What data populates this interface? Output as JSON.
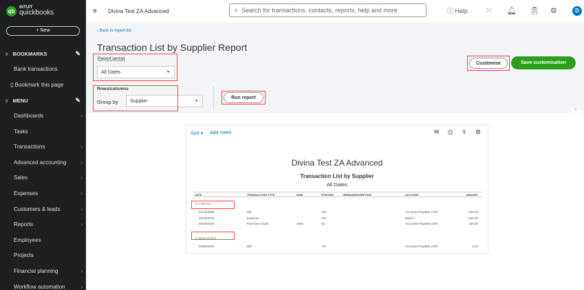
{
  "sidebar": {
    "brand_top": "INTUIT",
    "brand": "quickbooks",
    "new": "+ New",
    "bookmarks": "BOOKMARKS",
    "bookmark_items": [
      "Bank transactions"
    ],
    "bookmark_page": "Bookmark this page",
    "menu": "MENU",
    "items": [
      {
        "label": "Dashboards",
        "arrow": true
      },
      {
        "label": "Tasks",
        "arrow": false
      },
      {
        "label": "Transactions",
        "arrow": true
      },
      {
        "label": "Advanced accounting",
        "arrow": true
      },
      {
        "label": "Sales",
        "arrow": true
      },
      {
        "label": "Expenses",
        "arrow": true
      },
      {
        "label": "Customers & leads",
        "arrow": true
      },
      {
        "label": "Reports",
        "arrow": true
      },
      {
        "label": "Employees",
        "arrow": false
      },
      {
        "label": "Projects",
        "arrow": false
      },
      {
        "label": "Financial planning",
        "arrow": true
      },
      {
        "label": "Workflow automation",
        "arrow": true
      }
    ]
  },
  "topbar": {
    "company": "Divina Test ZA Advanced",
    "search_placeholder": "Search for transactions, contacts, reports, help and more",
    "help": "Help",
    "avatar": "D"
  },
  "page": {
    "back": "Back to report list",
    "title": "Transaction List by Supplier Report",
    "report_period_label": "Report period",
    "report_period": "All Dates",
    "rows_columns_label": "Rows/columns",
    "group_by_label": "Group by",
    "group_by": "Supplier",
    "run_report": "Run report",
    "customise": "Customise",
    "save_customisation": "Save customisation"
  },
  "report": {
    "sort": "Sort",
    "add_notes": "Add notes",
    "company": "Divina Test ZA Advanced",
    "title": "Transaction List by Supplier",
    "period": "All Dates",
    "columns": [
      "DATE",
      "TRANSACTION TYPE",
      "NUM",
      "POSTING",
      "MEMO/DESCRIPTION",
      "ACCOUNT",
      "AMOUNT"
    ],
    "groups": [
      {
        "name": "CARCAR",
        "rows": [
          [
            "01/23/2025",
            "Bill",
            "",
            "Yes",
            "",
            "Accounts Payable (A/P)",
            "200.00"
          ],
          [
            "02/20/2025",
            "Expense",
            "",
            "Yes",
            "",
            "Bank A",
            "-222.00"
          ],
          [
            "02/20/2025",
            "Purchase Order",
            "1003",
            "No",
            "",
            "Accounts Payable (A/P)",
            "100.00"
          ]
        ]
      },
      {
        "name": "Jasmine Rice",
        "rows": [
          [
            "04/08/2025",
            "Bill",
            "",
            "Yes",
            "",
            "Accounts Payable (A/P)",
            "0.00"
          ]
        ]
      }
    ]
  },
  "colors": {
    "sidebar": "#1e1f21",
    "green": "#2ca01c",
    "link": "#0077c5",
    "highlight": "#e24a4a"
  }
}
